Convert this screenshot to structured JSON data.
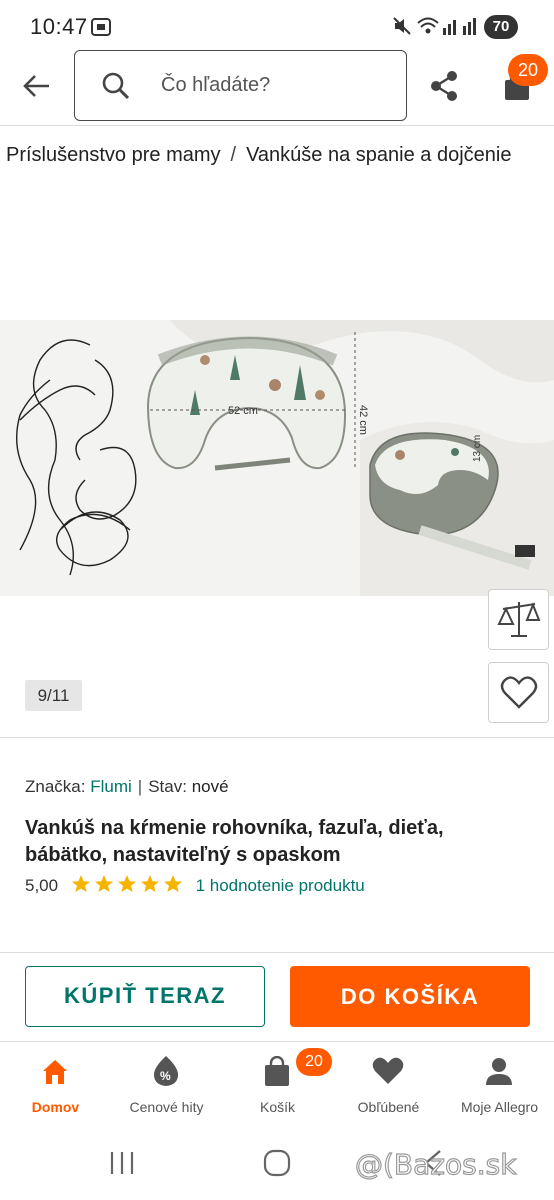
{
  "status_bar": {
    "time": "10:47",
    "battery": "70"
  },
  "search": {
    "placeholder": "Čo hľadáte?"
  },
  "header": {
    "cart_count": "20"
  },
  "breadcrumb": {
    "items": [
      "Príslušenstvo pre mamy",
      "Vankúše na spanie a dojčenie"
    ],
    "separator": "/"
  },
  "gallery": {
    "counter": "9/11",
    "dimensions": {
      "width_label": "52 cm",
      "height_label": "42 cm",
      "depth_label": "13 cm"
    }
  },
  "product": {
    "brand_label": "Značka:",
    "brand": "Flumi",
    "state_label": "Stav:",
    "state": "nové",
    "title": "Vankúš na kŕmenie rohovníka, fazuľa, dieťa, bábätko, nastaviteľný s opaskom",
    "rating_value": "5,00",
    "rating_stars": 5,
    "reviews": "1 hodnotenie produktu"
  },
  "actions": {
    "buy_now": "KÚPIŤ TERAZ",
    "add_to_cart": "DO KOŠÍKA"
  },
  "bottom_nav": {
    "items": [
      {
        "label": "Domov",
        "icon": "home-icon",
        "active": true
      },
      {
        "label": "Cenové hity",
        "icon": "price-tag-icon",
        "active": false
      },
      {
        "label": "Košík",
        "icon": "cart-icon",
        "active": false
      },
      {
        "label": "Obľúbené",
        "icon": "heart-icon",
        "active": false
      },
      {
        "label": "Moje Allegro",
        "icon": "user-icon",
        "active": false
      }
    ],
    "cart_badge": "20"
  },
  "watermark": "@(Bazos.sk",
  "colors": {
    "accent": "#ff5a00",
    "teal": "#00756a",
    "star": "#f5b400"
  }
}
